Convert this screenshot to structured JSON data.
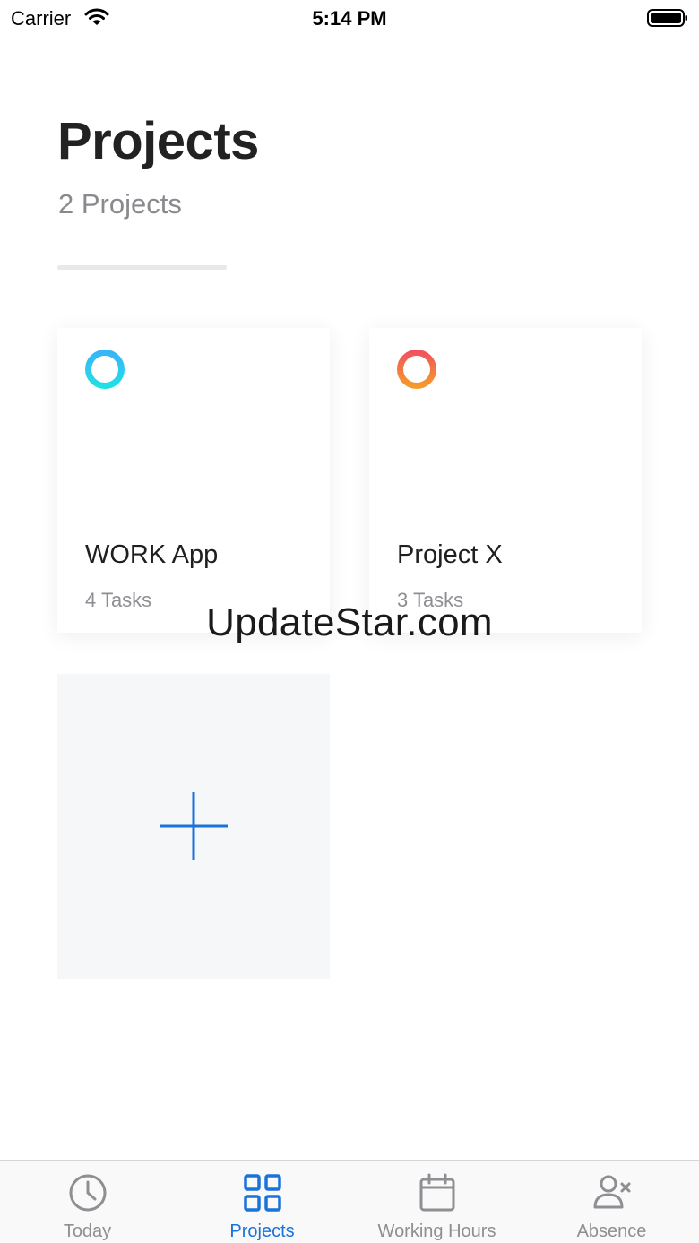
{
  "status_bar": {
    "carrier": "Carrier",
    "time": "5:14 PM"
  },
  "header": {
    "title": "Projects",
    "subtitle": "2 Projects"
  },
  "projects": [
    {
      "name": "WORK App",
      "tasks": "4 Tasks",
      "ring_colors": [
        "#3ab4f7",
        "#1fe0e6"
      ],
      "icon": "ring-icon"
    },
    {
      "name": "Project X",
      "tasks": "3 Tasks",
      "ring_colors": [
        "#f0555e",
        "#f59a2a"
      ],
      "icon": "ring-icon"
    }
  ],
  "add_project": {
    "icon": "plus-icon",
    "color": "#1a73d9"
  },
  "watermark": "UpdateStar.com",
  "tab_bar": {
    "active": "Projects",
    "active_color": "#1a73d9",
    "tabs": [
      {
        "label": "Today",
        "icon": "clock-icon"
      },
      {
        "label": "Projects",
        "icon": "grid-icon"
      },
      {
        "label": "Working Hours",
        "icon": "calendar-icon"
      },
      {
        "label": "Absence",
        "icon": "person-x-icon"
      }
    ]
  }
}
